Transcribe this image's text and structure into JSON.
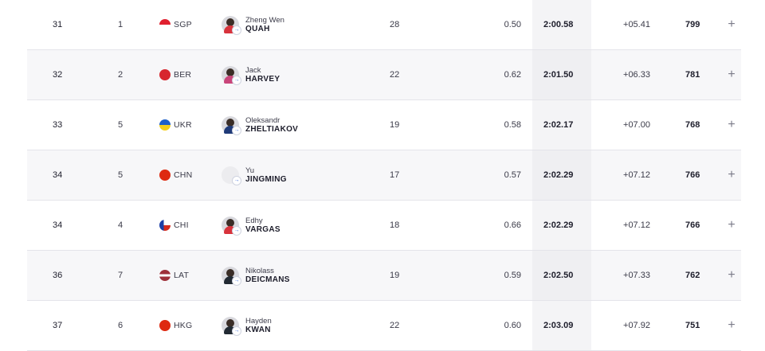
{
  "rows": [
    {
      "rank": "31",
      "heat": "1",
      "noc": "SGP",
      "first": "Zheng Wen",
      "last": "QUAH",
      "age": "28",
      "rt": "0.50",
      "time": "2:00.58",
      "diff": "+05.41",
      "pts": "799",
      "expand": "+",
      "flag": "sgp",
      "avatar": "red"
    },
    {
      "rank": "32",
      "heat": "2",
      "noc": "BER",
      "first": "Jack",
      "last": "HARVEY",
      "age": "22",
      "rt": "0.62",
      "time": "2:01.50",
      "diff": "+06.33",
      "pts": "781",
      "expand": "+",
      "flag": "ber",
      "avatar": "pink"
    },
    {
      "rank": "33",
      "heat": "5",
      "noc": "UKR",
      "first": "Oleksandr",
      "last": "ZHELTIAKOV",
      "age": "19",
      "rt": "0.58",
      "time": "2:02.17",
      "diff": "+07.00",
      "pts": "768",
      "expand": "+",
      "flag": "ukr",
      "avatar": "navy"
    },
    {
      "rank": "34",
      "heat": "5",
      "noc": "CHN",
      "first": "Yu",
      "last": "JINGMING",
      "age": "17",
      "rt": "0.57",
      "time": "2:02.29",
      "diff": "+07.12",
      "pts": "766",
      "expand": "+",
      "flag": "chn",
      "avatar": "blank"
    },
    {
      "rank": "34",
      "heat": "4",
      "noc": "CHI",
      "first": "Edhy",
      "last": "VARGAS",
      "age": "18",
      "rt": "0.66",
      "time": "2:02.29",
      "diff": "+07.12",
      "pts": "766",
      "expand": "+",
      "flag": "chi",
      "avatar": "red"
    },
    {
      "rank": "36",
      "heat": "7",
      "noc": "LAT",
      "first": "Nikolass",
      "last": "DEICMANS",
      "age": "19",
      "rt": "0.59",
      "time": "2:02.50",
      "diff": "+07.33",
      "pts": "762",
      "expand": "+",
      "flag": "lat",
      "avatar": "dark"
    },
    {
      "rank": "37",
      "heat": "6",
      "noc": "HKG",
      "first": "Hayden",
      "last": "KWAN",
      "age": "22",
      "rt": "0.60",
      "time": "2:03.09",
      "diff": "+07.92",
      "pts": "751",
      "expand": "+",
      "flag": "hkg",
      "avatar": "dark"
    }
  ],
  "colors": {
    "row_alt": "#f7f7f9",
    "divider": "#e4e4ea",
    "time_col": "#f4f4f6",
    "text": "#1d1d2b",
    "muted": "#3a3a48"
  },
  "icons": {
    "expand": "plus-icon",
    "athlete_link": "arrow-right-icon"
  }
}
